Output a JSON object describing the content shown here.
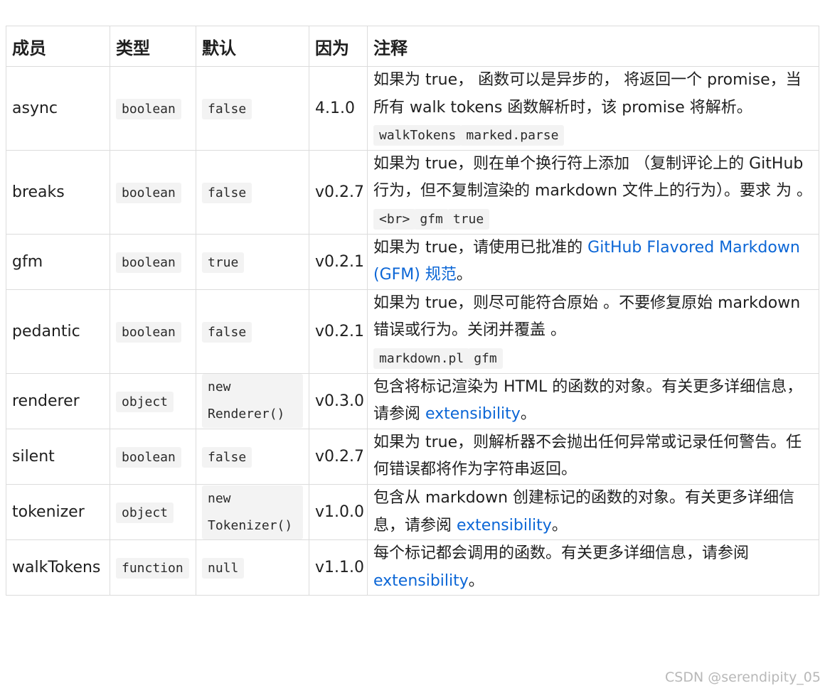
{
  "header": {
    "member": "成员",
    "type": "类型",
    "default": "默认",
    "since": "因为",
    "notes": "注释"
  },
  "rows": [
    {
      "member": "async",
      "type": "boolean",
      "default": "false",
      "since": "4.1.0",
      "note_text": "如果为 true， 函数可以是异步的， 将返回一个 promise，当所有 walk tokens 函数解析时，该 promise 将解析。",
      "note_code": [
        "walkTokens",
        "marked.parse"
      ]
    },
    {
      "member": "breaks",
      "type": "boolean",
      "default": "false",
      "since": "v0.2.7",
      "note_text": "如果为 true，则在单个换行符上添加 （复制评论上的 GitHub 行为，但不复制渲染的 markdown 文件上的行为）。要求 为 。",
      "note_code": [
        "<br>",
        "gfm",
        "true"
      ]
    },
    {
      "member": "gfm",
      "type": "boolean",
      "default": "true",
      "since": "v0.2.1",
      "note_text": "如果为 true，请使用已批准的",
      "note_link": "GitHub Flavored Markdown (GFM) 规范",
      "note_tail": "。"
    },
    {
      "member": "pedantic",
      "type": "boolean",
      "default": "false",
      "since": "v0.2.1",
      "note_text": "如果为 true，则尽可能符合原始 。不要修复原始 markdown 错误或行为。关闭并覆盖 。",
      "note_code": [
        "markdown.pl",
        "gfm"
      ]
    },
    {
      "member": "renderer",
      "type": "object",
      "default": "new Renderer()",
      "since": "v0.3.0",
      "note_text": "包含将标记渲染为 HTML 的函数的对象。有关更多详细信息，请参阅",
      "note_link": "extensibility",
      "note_tail": "。"
    },
    {
      "member": "silent",
      "type": "boolean",
      "default": "false",
      "since": "v0.2.7",
      "note_text": "如果为 true，则解析器不会抛出任何异常或记录任何警告。任何错误都将作为字符串返回。"
    },
    {
      "member": "tokenizer",
      "type": "object",
      "default": "new Tokenizer()",
      "since": "v1.0.0",
      "note_text": "包含从 markdown 创建标记的函数的对象。有关更多详细信息，请参阅",
      "note_link": "extensibility",
      "note_tail": "。"
    },
    {
      "member": "walkTokens",
      "type": "function",
      "default": "null",
      "since": "v1.1.0",
      "note_text": "每个标记都会调用的函数。有关更多详细信息，请参阅",
      "note_link": "extensibility",
      "note_tail": "。"
    }
  ],
  "watermark": "CSDN @serendipity_05",
  "colors": {
    "link": "#0b66d6",
    "code_bg": "#f3f3f3",
    "border": "#dcdcdc"
  }
}
